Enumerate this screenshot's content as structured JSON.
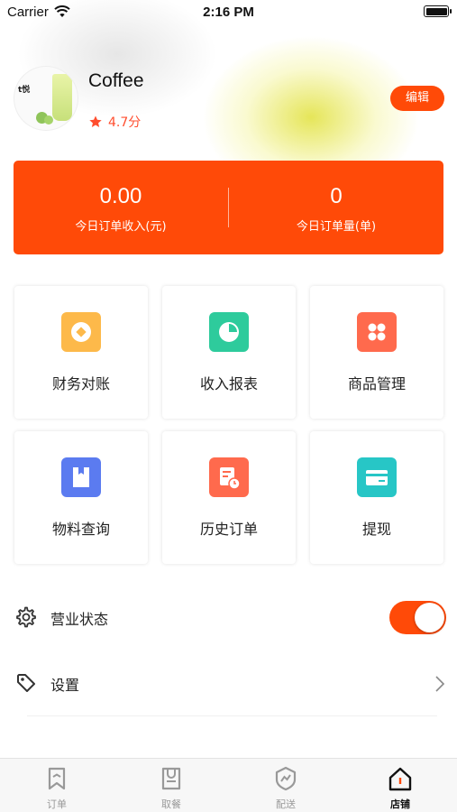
{
  "status_bar": {
    "carrier": "Carrier",
    "time": "2:16 PM"
  },
  "profile": {
    "shop_name": "Coffee",
    "rating": "4.7分",
    "edit_label": "编辑",
    "avatar_logo_text": "t悦"
  },
  "stats": {
    "income": {
      "value": "0.00",
      "label": "今日订单收入(元)"
    },
    "orders": {
      "value": "0",
      "label": "今日订单量(单)"
    }
  },
  "grid": [
    {
      "label": "财务对账",
      "icon": "coin-icon",
      "color": "#FDB94A"
    },
    {
      "label": "收入报表",
      "icon": "pie-chart-icon",
      "color": "#2ECB9C"
    },
    {
      "label": "商品管理",
      "icon": "grid-icon",
      "color": "#FF6A4D"
    },
    {
      "label": "物料查询",
      "icon": "material-box-icon",
      "color": "#5B7BF0"
    },
    {
      "label": "历史订单",
      "icon": "history-order-icon",
      "color": "#FF6A4D"
    },
    {
      "label": "提现",
      "icon": "card-icon",
      "color": "#27C6C6"
    }
  ],
  "rows": {
    "business_status": {
      "label": "营业状态",
      "toggle_on": true
    },
    "settings": {
      "label": "设置"
    }
  },
  "tabs": [
    {
      "label": "订单",
      "icon": "order-bookmark-icon",
      "active": false
    },
    {
      "label": "取餐",
      "icon": "pickup-bag-icon",
      "active": false
    },
    {
      "label": "配送",
      "icon": "delivery-shield-icon",
      "active": false
    },
    {
      "label": "店铺",
      "icon": "store-house-icon",
      "active": true
    }
  ],
  "colors": {
    "accent": "#FF4A08",
    "rating": "#FF4D2E"
  }
}
